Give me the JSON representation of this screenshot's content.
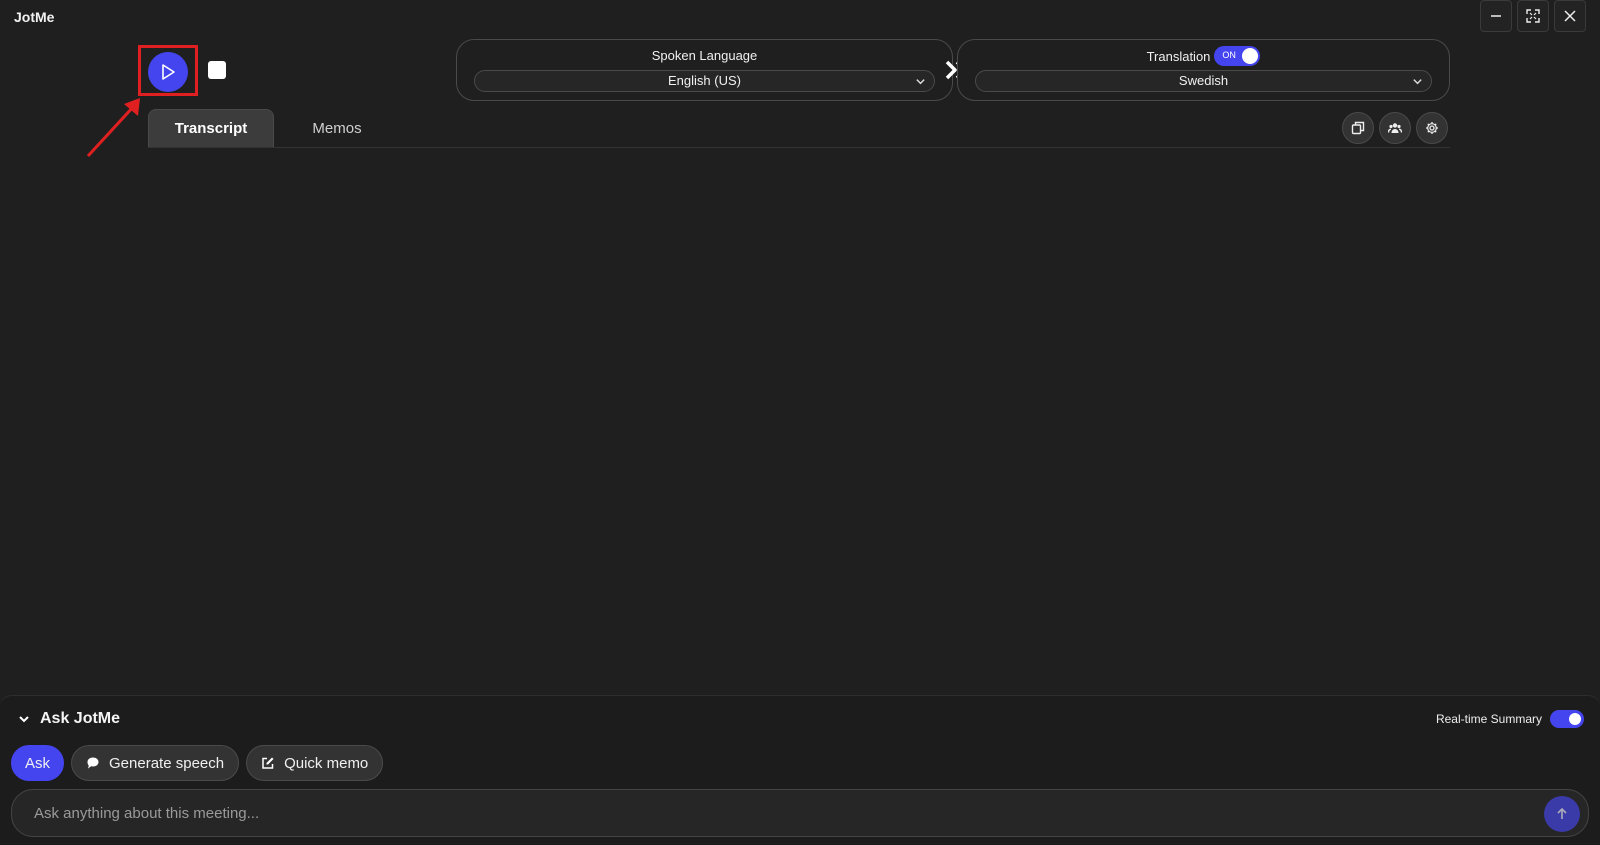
{
  "app": {
    "title": "JotMe"
  },
  "language": {
    "spoken_label": "Spoken Language",
    "spoken_value": "English (US)",
    "translation_label": "Translation",
    "translation_toggle": "ON",
    "translation_value": "Swedish"
  },
  "tabs": [
    {
      "label": "Transcript",
      "active": true
    },
    {
      "label": "Memos",
      "active": false
    }
  ],
  "ask": {
    "title": "Ask JotMe",
    "realtime_label": "Real-time Summary",
    "chips": {
      "ask": "Ask",
      "generate_speech": "Generate speech",
      "quick_memo": "Quick memo"
    },
    "placeholder": "Ask anything about this meeting..."
  },
  "colors": {
    "accent": "#4545f0",
    "background": "#1f1f1f",
    "annotation": "#e02020"
  }
}
